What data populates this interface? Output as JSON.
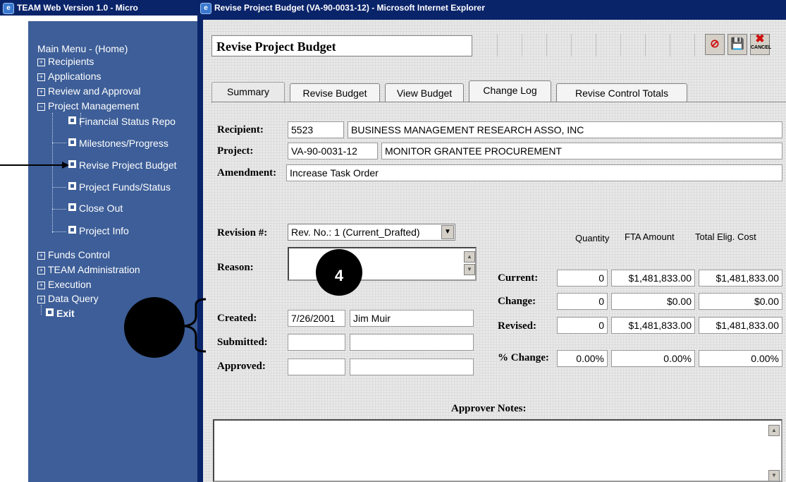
{
  "left_window": {
    "title": "TEAM Web Version 1.0 - Micro",
    "menu": {
      "home": "Main Menu - (Home)",
      "recipients": "Recipients",
      "applications": "Applications",
      "review": "Review and Approval",
      "project_mgmt": "Project Management",
      "sub": [
        "Financial Status Repo",
        "Milestones/Progress",
        "Revise Project Budget",
        "Project Funds/Status",
        "Close Out",
        "Project Info"
      ],
      "funds_control": "Funds Control",
      "team_admin": "TEAM Administration",
      "execution": "Execution",
      "data_query": "Data Query",
      "exit": "Exit"
    }
  },
  "right_window": {
    "title": "Revise Project Budget (VA-90-0031-12) - Microsoft Internet Explorer",
    "heading": "Revise Project Budget",
    "tabs": [
      "Summary",
      "Revise Budget",
      "View Budget",
      "Change Log",
      "Revise Control Totals"
    ],
    "labels": {
      "recipient": "Recipient:",
      "project": "Project:",
      "amendment": "Amendment:",
      "revision": "Revision #:",
      "reason": "Reason:",
      "created": "Created:",
      "submitted": "Submitted:",
      "approved": "Approved:",
      "current": "Current:",
      "change": "Change:",
      "revised": "Revised:",
      "pct_change": "% Change:",
      "approver_notes": "Approver Notes:"
    },
    "recipient_id": "5523",
    "recipient_name": "BUSINESS MANAGEMENT RESEARCH ASSO, INC",
    "project_id": "VA-90-0031-12",
    "project_name": "MONITOR GRANTEE PROCUREMENT",
    "amendment": "Increase Task Order",
    "revision_selected": "Rev. No.: 1  (Current_Drafted)",
    "created_date": "7/26/2001",
    "created_by": "Jim Muir",
    "columns": [
      "Quantity",
      "FTA Amount",
      "Total Elig. Cost"
    ],
    "current": [
      "0",
      "$1,481,833.00",
      "$1,481,833.00"
    ],
    "change": [
      "0",
      "$0.00",
      "$0.00"
    ],
    "revised": [
      "0",
      "$1,481,833.00",
      "$1,481,833.00"
    ],
    "pct_change": [
      "0.00%",
      "0.00%",
      "0.00%"
    ]
  },
  "annotation_number": "4",
  "icons": {
    "ie": "internet-explorer-icon",
    "undo": "no-edit-icon",
    "save": "save-icon",
    "cancel": "cancel-icon",
    "cancel_caption": "CANCEL"
  }
}
